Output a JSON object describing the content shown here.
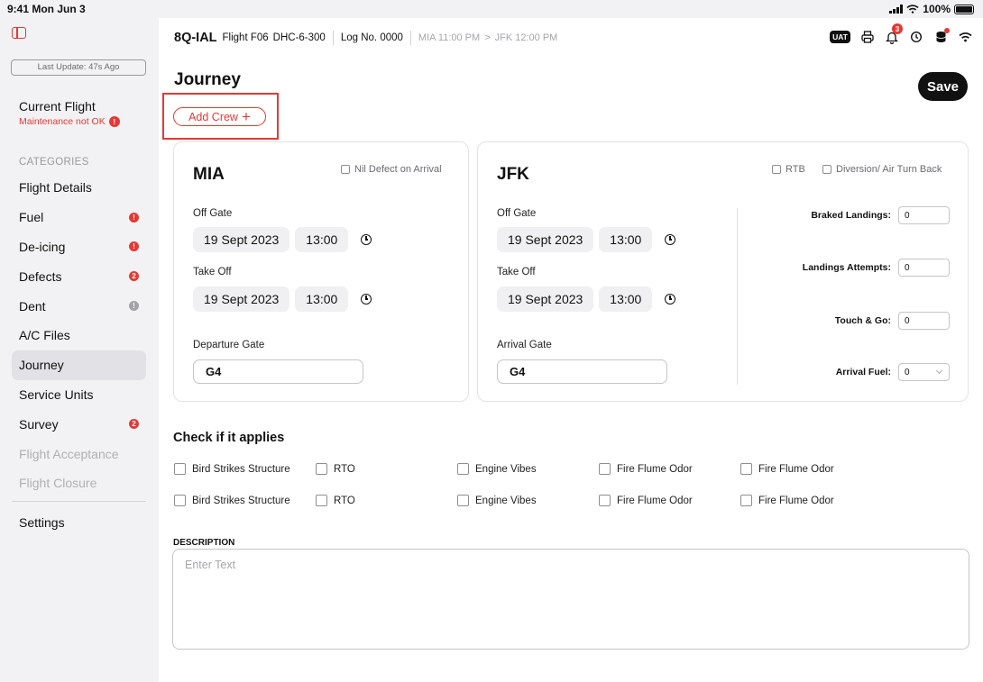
{
  "status_bar": {
    "time": "9:41 Mon Jun 3",
    "battery": "100%"
  },
  "sidebar": {
    "last_update": "Last Update: 47s Ago",
    "current_flight": {
      "title": "Current Flight",
      "warning": "Maintenance not OK",
      "warning_badge": "!"
    },
    "categories_label": "CATEGORIES",
    "items": [
      {
        "label": "Flight Details",
        "badge": ""
      },
      {
        "label": "Fuel",
        "badge": "!"
      },
      {
        "label": "De-icing",
        "badge": "!"
      },
      {
        "label": "Defects",
        "badge": "2"
      },
      {
        "label": "Dent",
        "badge": "!"
      },
      {
        "label": "A/C Files",
        "badge": ""
      },
      {
        "label": "Journey",
        "badge": ""
      },
      {
        "label": "Service Units",
        "badge": ""
      },
      {
        "label": "Survey",
        "badge": "2"
      },
      {
        "label": "Flight Acceptance",
        "badge": ""
      },
      {
        "label": "Flight Closure",
        "badge": ""
      }
    ],
    "settings": "Settings"
  },
  "header": {
    "registration": "8Q-IAL",
    "flight": "Flight F06",
    "aircraft": "DHC-6-300",
    "log": "Log No. 0000",
    "origin": "MIA 11:00 PM",
    "arrow": ">",
    "destination": "JFK 12:00 PM",
    "env_badge": "UAT",
    "notification_count": "3"
  },
  "page": {
    "title": "Journey",
    "save_label": "Save",
    "add_crew_label": "Add Crew",
    "add_crew_icon": "+"
  },
  "departure": {
    "code": "MIA",
    "nil_defect_label": "Nil Defect on Arrival",
    "off_gate_label": "Off Gate",
    "off_gate_date": "19 Sept 2023",
    "off_gate_time": "13:00",
    "take_off_label": "Take Off",
    "take_off_date": "19 Sept 2023",
    "take_off_time": "13:00",
    "gate_label": "Departure Gate",
    "gate_value": "G4"
  },
  "arrival": {
    "code": "JFK",
    "rtb_label": "RTB",
    "diversion_label": "Diversion/ Air Turn Back",
    "off_gate_label": "Off Gate",
    "off_gate_date": "19 Sept 2023",
    "off_gate_time": "13:00",
    "take_off_label": "Take Off",
    "take_off_date": "19 Sept 2023",
    "take_off_time": "13:00",
    "gate_label": "Arrival Gate",
    "gate_value": "G4",
    "braked_landings_label": "Braked Landings:",
    "braked_landings_value": "0",
    "landing_attempts_label": "Landings Attempts:",
    "landing_attempts_value": "0",
    "touch_go_label": "Touch & Go:",
    "touch_go_value": "0",
    "arrival_fuel_label": "Arrival Fuel:",
    "arrival_fuel_value": "0"
  },
  "checks": {
    "title": "Check if it applies",
    "row1": [
      "Bird Strikes Structure",
      "RTO",
      "Engine Vibes",
      "Fire Flume Odor",
      "Fire Flume Odor"
    ],
    "row2": [
      "Bird Strikes Structure",
      "RTO",
      "Engine Vibes",
      "Fire Flume Odor",
      "Fire Flume Odor"
    ]
  },
  "description": {
    "label": "DESCRIPTION",
    "placeholder": "Enter Text"
  },
  "colors": {
    "accent_red": "#e53935",
    "save_bg": "#111111",
    "sidebar_bg": "#f2f2f4"
  }
}
